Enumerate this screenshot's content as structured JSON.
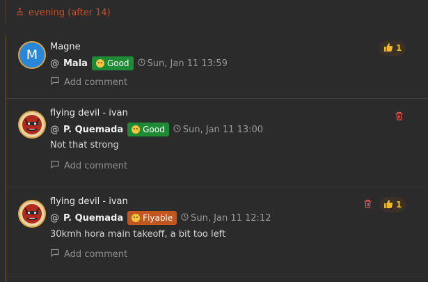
{
  "section": {
    "label": "evening (after 14)",
    "icon": "sunset-icon"
  },
  "reports": [
    {
      "author": "Magne",
      "avatar_letter": "M",
      "at_symbol": "@",
      "spot": "Mala",
      "rating": "Good",
      "timestamp": "Sun, Jan 11 13:59",
      "text": "",
      "add_comment": "Add comment",
      "likes": "1"
    },
    {
      "author": "flying devil - ivan",
      "at_symbol": "@",
      "spot": "P. Quemada",
      "rating": "Good",
      "timestamp": "Sun, Jan 11 13:00",
      "text": "Not that strong",
      "add_comment": "Add comment"
    },
    {
      "author": "flying devil - ivan",
      "at_symbol": "@",
      "spot": "P. Quemada",
      "rating": "Flyable",
      "timestamp": "Sun, Jan 11 12:12",
      "text": "30kmh hora main takeoff, a bit too left",
      "add_comment": "Add comment",
      "likes": "1"
    }
  ],
  "colors": {
    "background": "#2b2b2b",
    "section_accent": "#c2502e",
    "good": "#1e8a35",
    "flyable": "#c2561e",
    "like": "#f1b82a",
    "trash": "#d9534f"
  }
}
